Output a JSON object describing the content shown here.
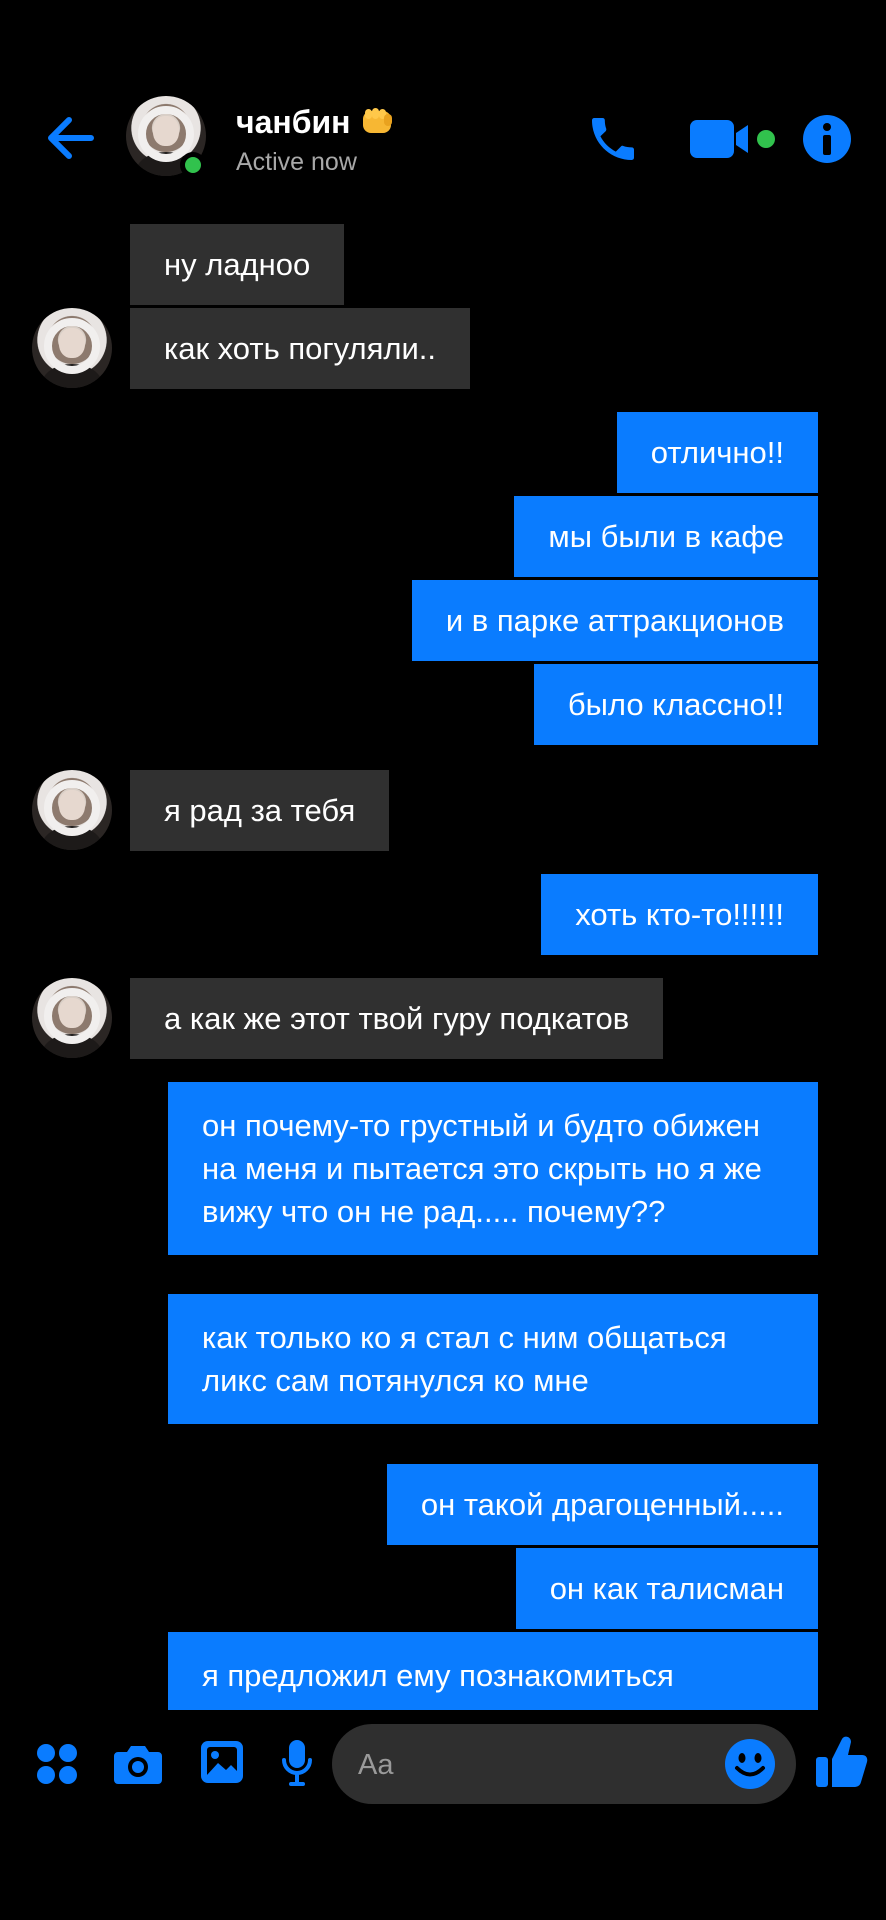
{
  "header": {
    "contact_name": "чанбин",
    "status": "Active now",
    "accent_color": "#0a7cff",
    "online_color": "#31c24d",
    "icons": [
      "back-arrow-icon",
      "phone-icon",
      "video-camera-icon",
      "info-icon"
    ]
  },
  "messages": [
    {
      "direction": "incoming",
      "text": "ну ладноо"
    },
    {
      "direction": "incoming",
      "text": "как хоть погуляли.."
    },
    {
      "direction": "outgoing",
      "text": "отлично!!"
    },
    {
      "direction": "outgoing",
      "text": "мы были в кафе"
    },
    {
      "direction": "outgoing",
      "text": "и в парке аттракционов"
    },
    {
      "direction": "outgoing",
      "text": "было классно!!"
    },
    {
      "direction": "incoming",
      "text": "я рад за тебя"
    },
    {
      "direction": "outgoing",
      "text": "хоть кто-то!!!!!!"
    },
    {
      "direction": "incoming",
      "text": "а как же этот твой гуру подкатов"
    },
    {
      "direction": "outgoing",
      "text": "он почему-то грустный и будто обижен на меня и пытается это скрыть но я же вижу что он не рад..... почему??"
    },
    {
      "direction": "outgoing",
      "text": "как только ко я стал с ним общаться ликс сам потянулся ко мне"
    },
    {
      "direction": "outgoing",
      "text": "он такой драгоценный....."
    },
    {
      "direction": "outgoing",
      "text": "он как талисман"
    },
    {
      "direction": "outgoing",
      "text": "я предложил ему познакомиться"
    }
  ],
  "composer": {
    "placeholder": "Aa",
    "icons": [
      "apps-grid-icon",
      "camera-icon",
      "gallery-icon",
      "microphone-icon",
      "emoji-icon",
      "thumbs-up-icon"
    ]
  },
  "colors": {
    "background": "#000000",
    "incoming_bubble": "#303030",
    "outgoing_bubble": "#0a7cff"
  }
}
